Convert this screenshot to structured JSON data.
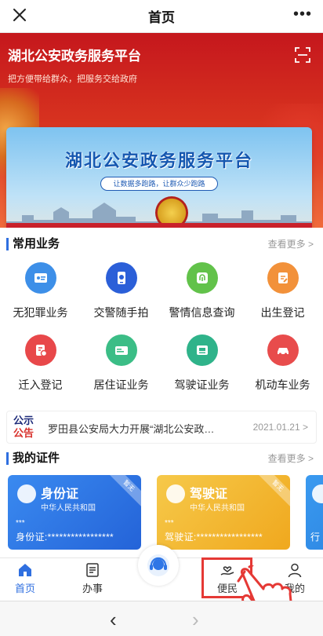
{
  "topnav": {
    "title": "首页",
    "close_icon": "close-icon",
    "more_label": "•••"
  },
  "hero": {
    "title": "湖北公安政务服务平台",
    "subtitle": "把方便带给群众，把服务交给政府",
    "banner_title": "湖北公安政务服务平台",
    "banner_slogan": "让数据多跑路，让群众少跑路",
    "carousel_active_index": 5,
    "carousel_count": 6
  },
  "common": {
    "section_title": "常用业务",
    "more": "查看更多 >",
    "items": [
      {
        "label": "无犯罪业务",
        "icon": "id-card-icon",
        "color": "#3d8fe8"
      },
      {
        "label": "交警随手拍",
        "icon": "phone-camera-icon",
        "color": "#2b5fd8"
      },
      {
        "label": "警情信息查询",
        "icon": "fingerprint-icon",
        "color": "#62c24a"
      },
      {
        "label": "出生登记",
        "icon": "document-edit-icon",
        "color": "#f2913a"
      },
      {
        "label": "迁入登记",
        "icon": "relocate-icon",
        "color": "#e8484a"
      },
      {
        "label": "居住证业务",
        "icon": "residence-card-icon",
        "color": "#3bbd86"
      },
      {
        "label": "驾驶证业务",
        "icon": "license-icon",
        "color": "#2fb38a"
      },
      {
        "label": "机动车业务",
        "icon": "car-icon",
        "color": "#e84c4c"
      }
    ]
  },
  "notice": {
    "tag_top": "公示",
    "tag_bottom": "公告",
    "text": "罗田县公安局大力开展“湖北公安政…",
    "date": "2021.01.21 >"
  },
  "certs": {
    "section_title": "我的证件",
    "more": "查看更多 >",
    "cards": [
      {
        "title": "身份证",
        "subtitle": "中华人民共和国",
        "mask": "***",
        "line": "身份证:*****************",
        "ribbon": "暂无",
        "color": "#2f76e6"
      },
      {
        "title": "驾驶证",
        "subtitle": "中华人民共和国",
        "mask": "***",
        "line": "驾驶证:*****************",
        "ribbon": "暂无",
        "color": "#f2b927"
      },
      {
        "title": "",
        "subtitle": "",
        "mask": "",
        "line": "行",
        "ribbon": "",
        "color": "#2f8be6"
      }
    ]
  },
  "tabbar": {
    "items": [
      {
        "label": "首页",
        "icon": "home-icon",
        "active": true
      },
      {
        "label": "办事",
        "icon": "book-icon",
        "active": false
      },
      {
        "label": "便民",
        "icon": "hand-heart-icon",
        "active": false
      },
      {
        "label": "我的",
        "icon": "user-icon",
        "active": false
      }
    ],
    "center_icon": "headset-service-icon"
  },
  "browser": {
    "back_label": "‹",
    "forward_label": "›"
  },
  "colors": {
    "accent": "#2f6fe0",
    "hero_red": "#c5171d",
    "highlight": "#e53935"
  }
}
